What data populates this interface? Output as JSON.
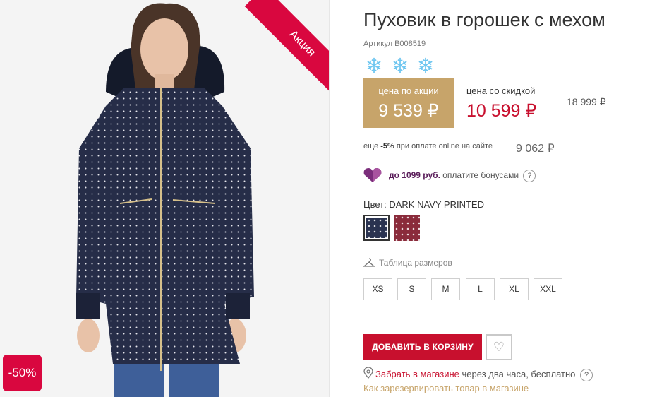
{
  "product": {
    "promo_ribbon": "Акция",
    "discount_badge": "-50%",
    "title": "Пуховик в горошек с мехом",
    "sku": "Артикул B008519"
  },
  "icons": {
    "warmth": [
      "snowflake-icon",
      "snowflake-icon",
      "snowflake-icon"
    ]
  },
  "pricing": {
    "promo_label": "цена по акции",
    "promo_price": "9 539 ₽",
    "discount_label": "цена со скидкой",
    "discount_price": "10 599 ₽",
    "old_price": "18 999 ₽",
    "extra_prefix": "еще ",
    "extra_percent": "-5%",
    "extra_suffix": " при оплате online на сайте",
    "extra_price": "9 062 ₽"
  },
  "bonus": {
    "amount": "до 1099 руб.",
    "text": " оплатите бонусами",
    "help": "?"
  },
  "color": {
    "label": "Цвет: DARK NAVY PRINTED",
    "options": [
      {
        "name": "DARK NAVY PRINTED",
        "hex": "#2a3350",
        "selected": true
      },
      {
        "name": "bordeaux",
        "hex": "#8a2b3b",
        "selected": false
      }
    ]
  },
  "sizes": {
    "table_link": "Таблица размеров",
    "options": [
      "XS",
      "S",
      "M",
      "L",
      "XL",
      "XXL"
    ]
  },
  "actions": {
    "add_to_cart": "ДОБАВИТЬ В КОРЗИНУ",
    "wishlist_icon": "heart-icon"
  },
  "delivery": {
    "pickup_link": "Забрать в магазине",
    "pickup_text": " через два часа, бесплатно",
    "help": "?",
    "reserve_link": "Как зарезервировать товар в магазине"
  },
  "colors": {
    "accent": "#c8102e",
    "promo_gold": "#c7a46a",
    "snowflake": "#6ec6f0",
    "bonus_purple": "#7b2d7b"
  }
}
